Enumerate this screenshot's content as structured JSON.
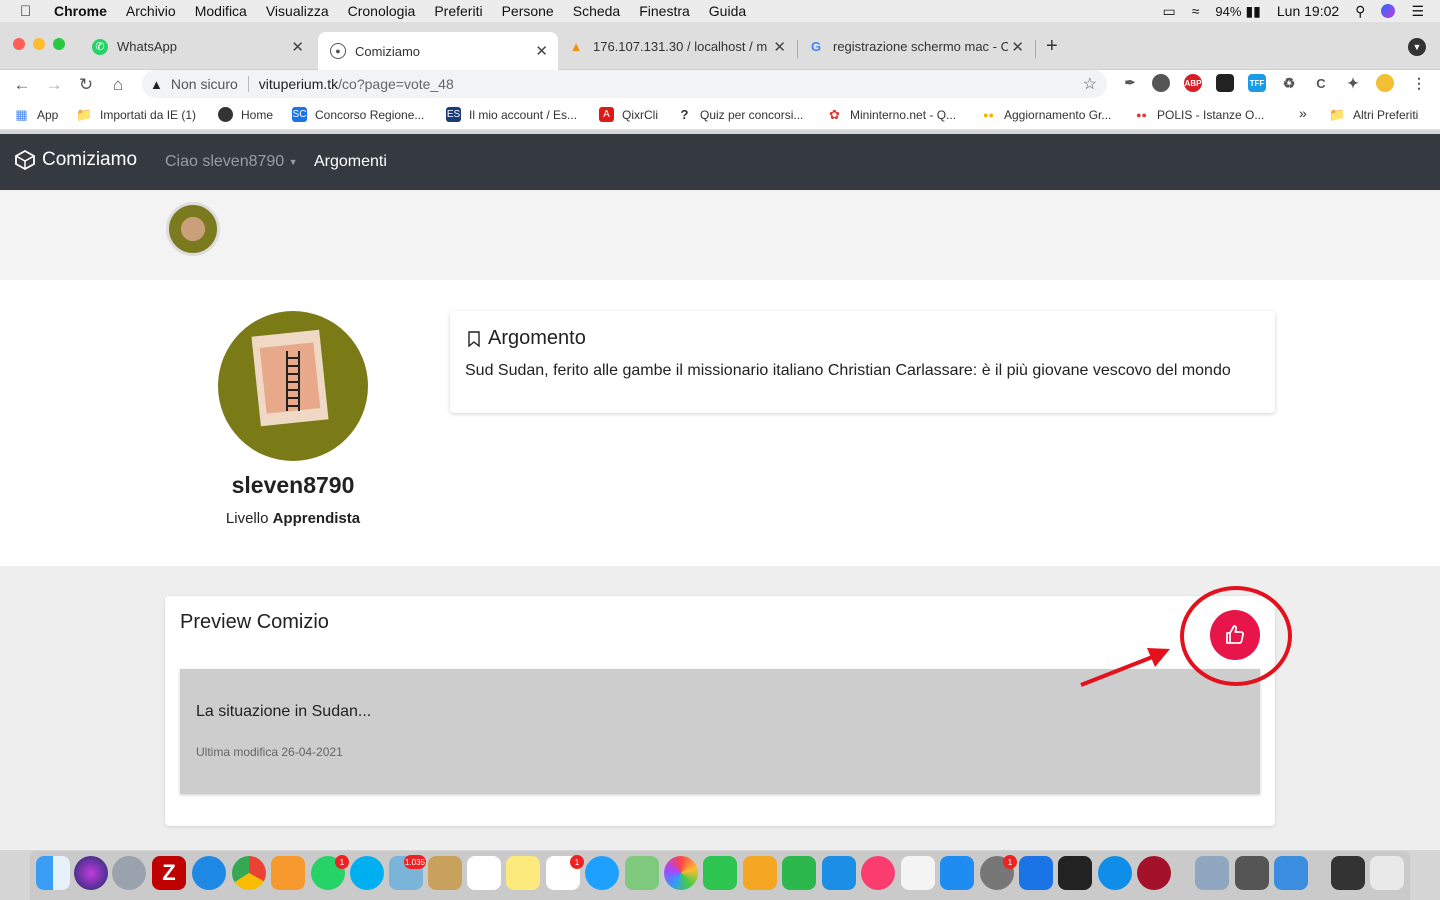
{
  "menubar": {
    "app": "Chrome",
    "items": [
      "Archivio",
      "Modifica",
      "Visualizza",
      "Cronologia",
      "Preferiti",
      "Persone",
      "Scheda",
      "Finestra",
      "Guida"
    ],
    "battery": "94%",
    "clock": "Lun 19:02"
  },
  "tabs": [
    {
      "label": "WhatsApp",
      "icon": "whatsapp-icon",
      "color": "#25d366"
    },
    {
      "label": "Comiziamo",
      "icon": "globe-icon",
      "color": "#555555"
    },
    {
      "label": "176.107.131.30 / localhost / mi",
      "icon": "phpmyadmin-icon",
      "color": "#f29111"
    },
    {
      "label": "registrazione schermo mac - C",
      "icon": "google-icon",
      "color": "#4285f4"
    }
  ],
  "address": {
    "security": "Non sicuro",
    "host": "vituperium.tk",
    "path": "/co?page=vote_48"
  },
  "bookmarks": [
    {
      "label": "App",
      "color": "#4285f4"
    },
    {
      "label": "Importati da IE (1)",
      "color": "#777777"
    },
    {
      "label": "Home",
      "color": "#333333"
    },
    {
      "label": "Concorso Regione...",
      "color": "#1a73e8"
    },
    {
      "label": "Il mio account / Es...",
      "color": "#1a3a7a"
    },
    {
      "label": "QixrCli",
      "color": "#dd1b16"
    },
    {
      "label": "Quiz per concorsi...",
      "color": "#333333"
    },
    {
      "label": "Mininterno.net - Q...",
      "color": "#e33333"
    },
    {
      "label": "Aggiornamento Gr...",
      "color": "#f4b400"
    },
    {
      "label": "POLIS - Istanze O...",
      "color": "#e53935"
    }
  ],
  "bookmarks_more": "»",
  "bookmarks_other": "Altri Preferiti",
  "site": {
    "brand": "Comiziamo",
    "user_menu": "Ciao sleven8790",
    "nav_link": "Argomenti"
  },
  "profile": {
    "username": "sleven8790",
    "level_label": "Livello",
    "level_value": "Apprendista"
  },
  "argomento": {
    "title": "Argomento",
    "text": "Sud Sudan, ferito alle gambe il missionario italiano Christian Carlassare: è il più giovane vescovo del mondo"
  },
  "preview": {
    "title": "Preview Comizio",
    "comizio_title": "La situazione in Sudan...",
    "comizio_date": "Ultima modifica 26-04-2021"
  },
  "colors": {
    "navbar": "#343a40",
    "like_button": "#e8154a",
    "annotation": "#e4101c"
  },
  "dock_badges": [
    "1",
    "1.035",
    "1",
    "1"
  ]
}
